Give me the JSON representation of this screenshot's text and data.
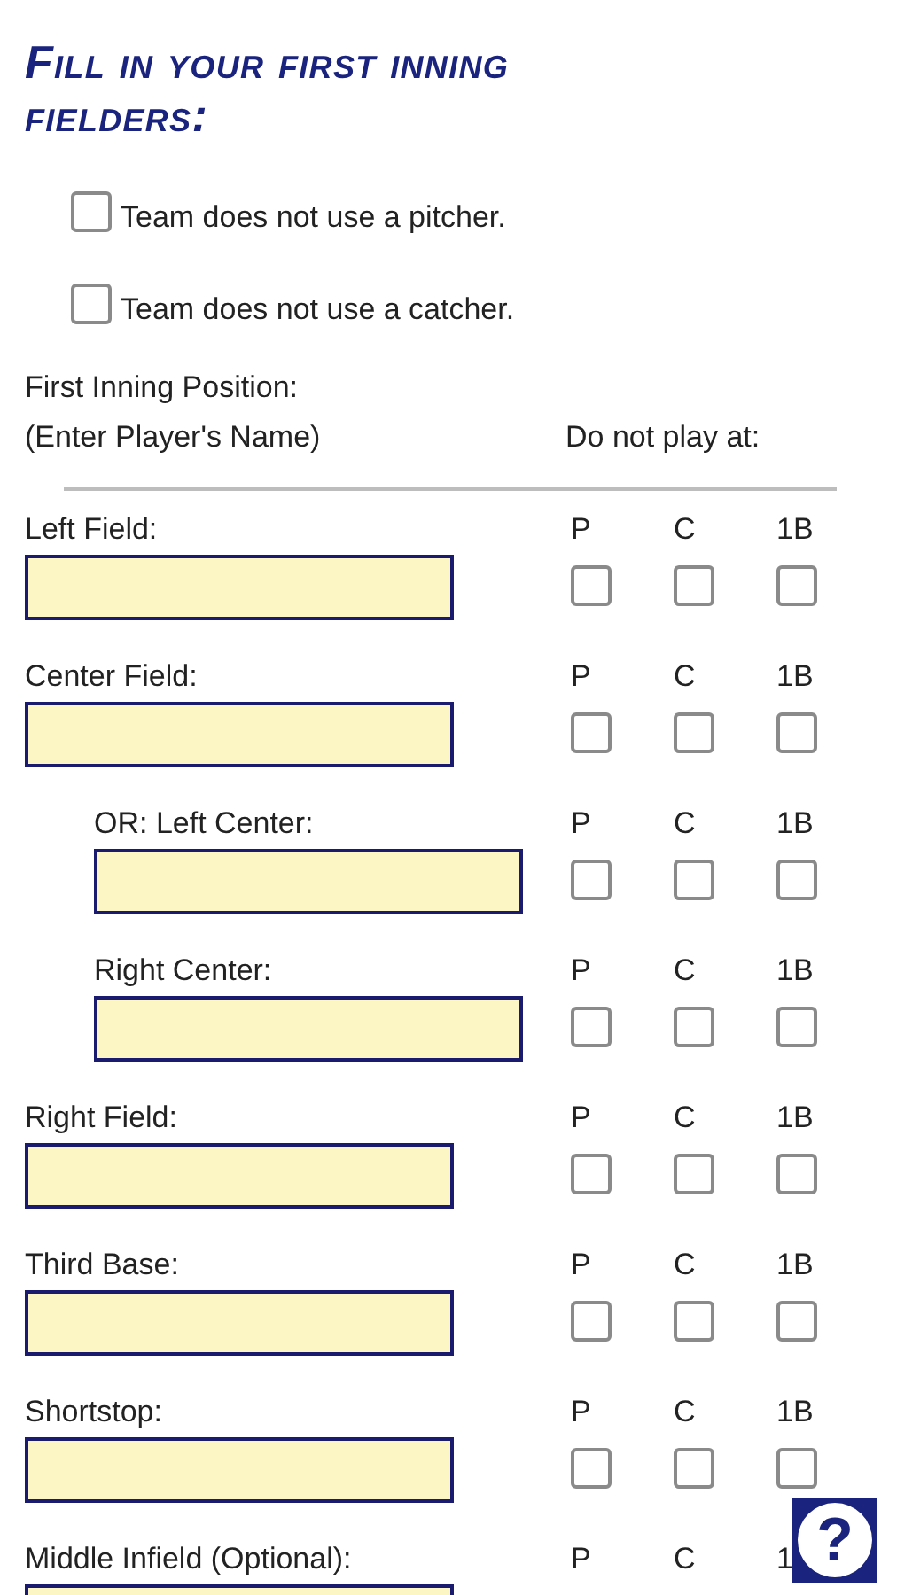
{
  "title": "Fill in your first inning fielders:",
  "options": [
    {
      "label": "Team does not use a pitcher.",
      "checked": false
    },
    {
      "label": "Team does not use a catcher.",
      "checked": false
    }
  ],
  "position_heading": "First Inning Position:",
  "name_hint": "(Enter Player's Name)",
  "exclude_heading": "Do not play at:",
  "positions": [
    {
      "label": "Left Field:",
      "indented": false,
      "checks": [
        {
          "label": "P",
          "checked": false
        },
        {
          "label": "C",
          "checked": false
        },
        {
          "label": "1B",
          "checked": false
        }
      ]
    },
    {
      "label": "Center Field:",
      "indented": false,
      "checks": [
        {
          "label": "P",
          "checked": false
        },
        {
          "label": "C",
          "checked": false
        },
        {
          "label": "1B",
          "checked": false
        }
      ]
    },
    {
      "label": "OR: Left Center:",
      "indented": true,
      "checks": [
        {
          "label": "P",
          "checked": false
        },
        {
          "label": "C",
          "checked": false
        },
        {
          "label": "1B",
          "checked": false
        }
      ]
    },
    {
      "label": "Right Center:",
      "indented": true,
      "checks": [
        {
          "label": "P",
          "checked": false
        },
        {
          "label": "C",
          "checked": false
        },
        {
          "label": "1B",
          "checked": false
        }
      ]
    },
    {
      "label": "Right Field:",
      "indented": false,
      "checks": [
        {
          "label": "P",
          "checked": false
        },
        {
          "label": "C",
          "checked": false
        },
        {
          "label": "1B",
          "checked": false
        }
      ]
    },
    {
      "label": "Third Base:",
      "indented": false,
      "checks": [
        {
          "label": "P",
          "checked": false
        },
        {
          "label": "C",
          "checked": false
        },
        {
          "label": "1B",
          "checked": false
        }
      ]
    },
    {
      "label": "Shortstop:",
      "indented": false,
      "checks": [
        {
          "label": "P",
          "checked": false
        },
        {
          "label": "C",
          "checked": false
        },
        {
          "label": "1B",
          "checked": false
        }
      ]
    },
    {
      "label": "Middle Infield (Optional):",
      "indented": false,
      "checks": [
        {
          "label": "P"
        },
        {
          "label": "C"
        },
        {
          "label": "1"
        }
      ]
    }
  ],
  "help_button": "?"
}
